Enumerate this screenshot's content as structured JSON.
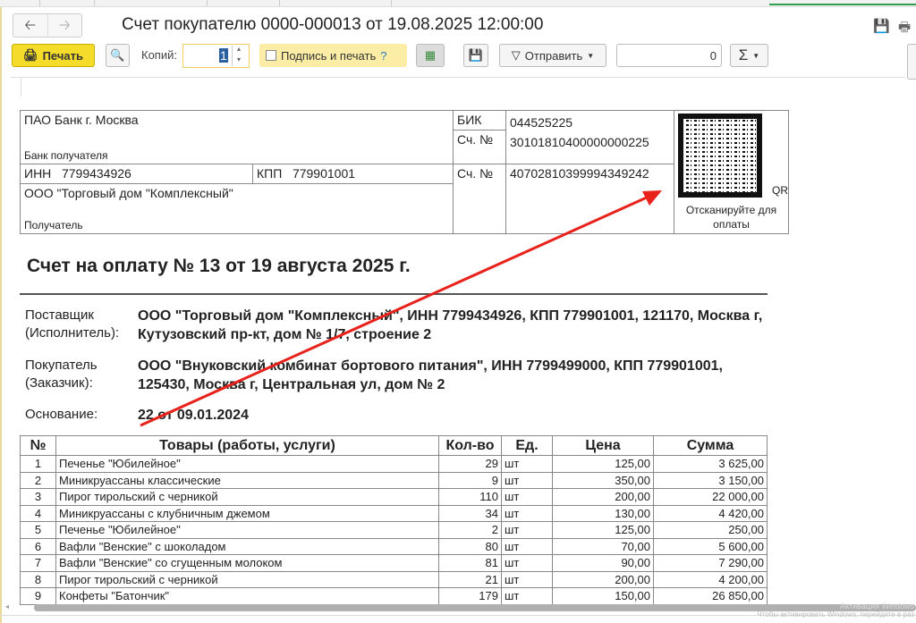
{
  "window": {
    "title": "Счет покупателю 0000-000013 от 19.08.2025 12:00:00"
  },
  "toolbar": {
    "print": "Печать",
    "copies_label": "Копий:",
    "copies_value": "1",
    "sign_print": "Подпись и печать",
    "help": "?",
    "send": "Отправить",
    "sum_value": "0",
    "sigma": "Σ"
  },
  "bank": {
    "bank_name": "ПАО Банк г. Москва",
    "bank_label": "Банк получателя",
    "bik_label": "БИК",
    "bik": "044525225",
    "corr_label": "Сч. №",
    "corr": "30101810400000000225",
    "inn_label": "ИНН",
    "inn": "7799434926",
    "kpp_label": "КПП",
    "kpp": "779901001",
    "acc_label": "Сч. №",
    "acc": "40702810399994349242",
    "recipient": "ООО \"Торговый дом \"Комплексный\"",
    "recipient_label": "Получатель",
    "qr_label": "QR",
    "qr_caption": "Отсканируйте для оплаты"
  },
  "invoice": {
    "heading": "Счет на оплату № 13 от 19 августа 2025 г.",
    "supplier_label": "Поставщик (Исполнитель):",
    "supplier": "ООО \"Торговый дом \"Комплексный\", ИНН 7799434926, КПП 779901001, 121170, Москва г, Кутузовский пр-кт, дом № 1/7, строение 2",
    "buyer_label": "Покупатель (Заказчик):",
    "buyer": "ООО \"Внуковский комбинат бортового питания\", ИНН 7799499000, КПП 779901001, 125430, Москва г, Центральная ул, дом № 2",
    "basis_label": "Основание:",
    "basis": "22 от 09.01.2024"
  },
  "table": {
    "headers": [
      "№",
      "Товары (работы, услуги)",
      "Кол-во",
      "Ед.",
      "Цена",
      "Сумма"
    ],
    "rows": [
      [
        "1",
        "Печенье \"Юбилейное\"",
        "29",
        "шт",
        "125,00",
        "3 625,00"
      ],
      [
        "2",
        "Миникруассаны классические",
        "9",
        "шт",
        "350,00",
        "3 150,00"
      ],
      [
        "3",
        "Пирог тирольский с черникой",
        "110",
        "шт",
        "200,00",
        "22 000,00"
      ],
      [
        "4",
        "Миникруассаны с клубничным джемом",
        "34",
        "шт",
        "130,00",
        "4 420,00"
      ],
      [
        "5",
        "Печенье \"Юбилейное\"",
        "2",
        "шт",
        "125,00",
        "250,00"
      ],
      [
        "6",
        "Вафли \"Венские\" с шоколадом",
        "80",
        "шт",
        "70,00",
        "5 600,00"
      ],
      [
        "7",
        "Вафли \"Венские\" со сгущенным молоком",
        "81",
        "шт",
        "90,00",
        "7 290,00"
      ],
      [
        "8",
        "Пирог тирольский с черникой",
        "21",
        "шт",
        "200,00",
        "4 200,00"
      ],
      [
        "9",
        "Конфеты \"Батончик\"",
        "179",
        "шт",
        "150,00",
        "26 850,00"
      ]
    ]
  },
  "watermark": {
    "line1": "Активация Windows",
    "line2": "Чтобы активировать Windows, перейдите в раз"
  },
  "colors": {
    "print_button": "#f5dc2a",
    "annotation_arrow": "#e8211b"
  }
}
